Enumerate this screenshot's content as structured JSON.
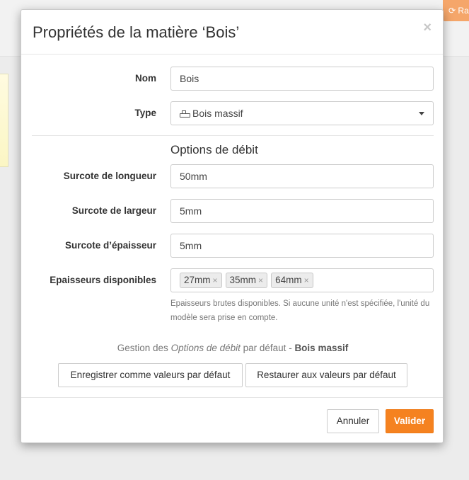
{
  "background": {
    "refresh_label": "Ra"
  },
  "modal": {
    "title": "Propriétés de la matière ‘Bois’",
    "close_glyph": "×",
    "fields": {
      "nom": {
        "label": "Nom",
        "value": "Bois"
      },
      "type": {
        "label": "Type",
        "value": "Bois massif",
        "icon": "hammer-icon"
      }
    },
    "section_title": "Options de débit",
    "cut_options": {
      "longueur": {
        "label": "Surcote de longueur",
        "value": "50mm"
      },
      "largeur": {
        "label": "Surcote de largeur",
        "value": "5mm"
      },
      "epaisseur": {
        "label": "Surcote d’épaisseur",
        "value": "5mm"
      },
      "epaisseurs_disponibles": {
        "label": "Epaisseurs disponibles",
        "tags": [
          "27mm",
          "35mm",
          "64mm"
        ],
        "remove_glyph": "×"
      }
    },
    "help_text": "Epaisseurs brutes disponibles. Si aucune unité n'est spécifiée, l'unité du modèle sera prise en compte.",
    "defaults": {
      "prefix": "Gestion des ",
      "emphasis": "Options de débit",
      "middle": " par défaut - ",
      "strong": "Bois massif",
      "save_label": "Enregistrer comme valeurs par défaut",
      "restore_label": "Restaurer aux valeurs par défaut"
    },
    "footer": {
      "cancel_label": "Annuler",
      "confirm_label": "Valider"
    }
  },
  "colors": {
    "accent": "#f58220",
    "refresh_button": "#f5a66a"
  }
}
